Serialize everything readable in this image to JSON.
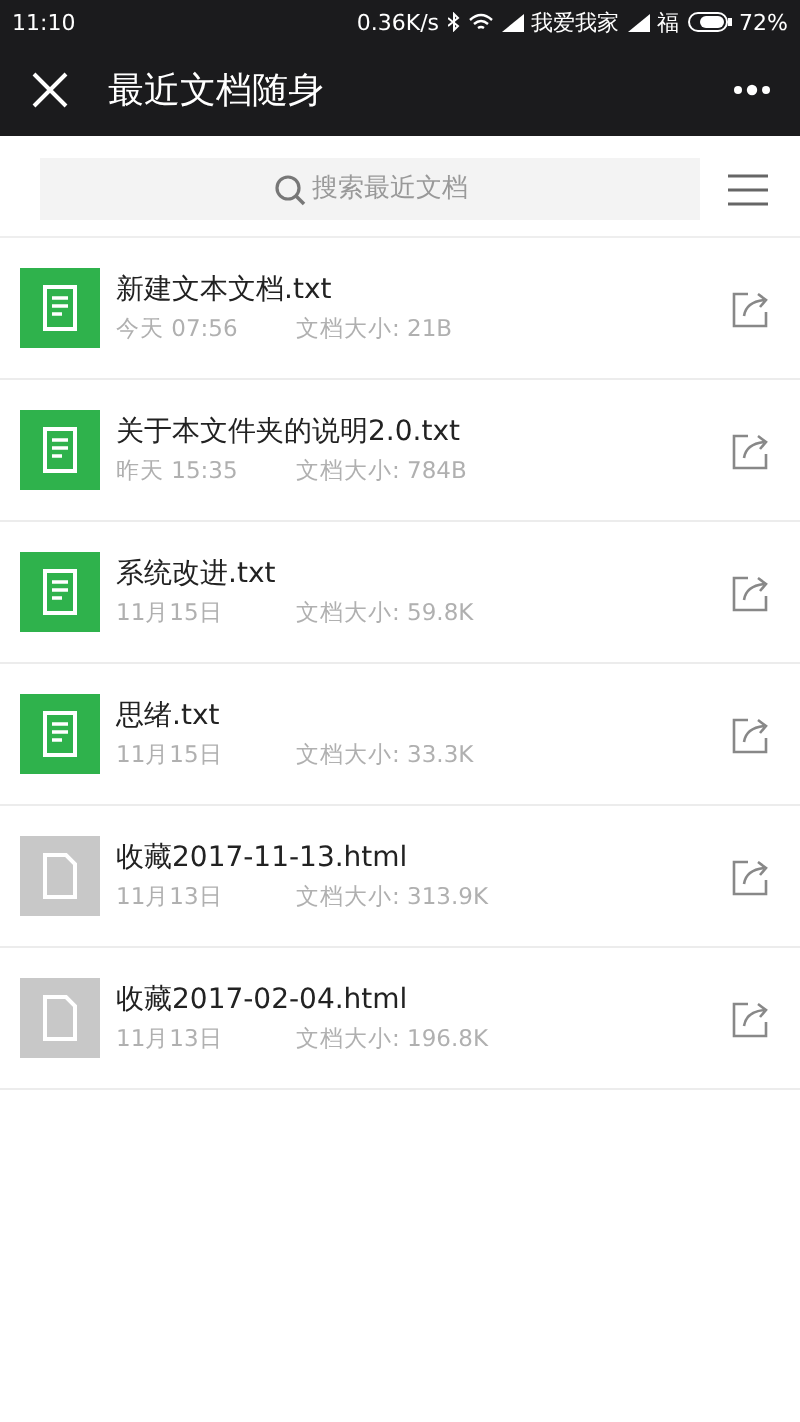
{
  "status_bar": {
    "time": "11:10",
    "speed": "0.36K/s",
    "carrier_1": "我爱我家",
    "carrier_2": "福",
    "battery": "72%"
  },
  "title_bar": {
    "title": "最近文档随身"
  },
  "search": {
    "placeholder": "搜索最近文档"
  },
  "files": [
    {
      "kind": "text",
      "name": "新建文本文档.txt",
      "date": "今天 07:56",
      "size": "文档大小: 21B"
    },
    {
      "kind": "text",
      "name": "关于本文件夹的说明2.0.txt",
      "date": "昨天 15:35",
      "size": "文档大小: 784B"
    },
    {
      "kind": "text",
      "name": "系统改进.txt",
      "date": "11月15日",
      "size": "文档大小: 59.8K"
    },
    {
      "kind": "text",
      "name": "思绪.txt",
      "date": "11月15日",
      "size": "文档大小: 33.3K"
    },
    {
      "kind": "generic",
      "name": "收藏2017-11-13.html",
      "date": "11月13日",
      "size": "文档大小: 313.9K"
    },
    {
      "kind": "generic",
      "name": "收藏2017-02-04.html",
      "date": "11月13日",
      "size": "文档大小: 196.8K"
    }
  ]
}
